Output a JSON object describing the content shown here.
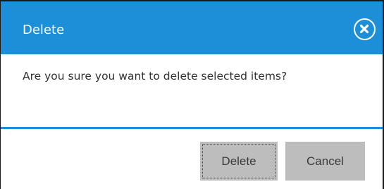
{
  "dialog": {
    "title": "Delete",
    "message": "Are you sure you want to delete selected items?",
    "close_icon": "close-circle-icon",
    "buttons": {
      "delete_label": "Delete",
      "cancel_label": "Cancel"
    },
    "colors": {
      "header": "#1d8fd8",
      "button": "#bdbdbd"
    }
  }
}
